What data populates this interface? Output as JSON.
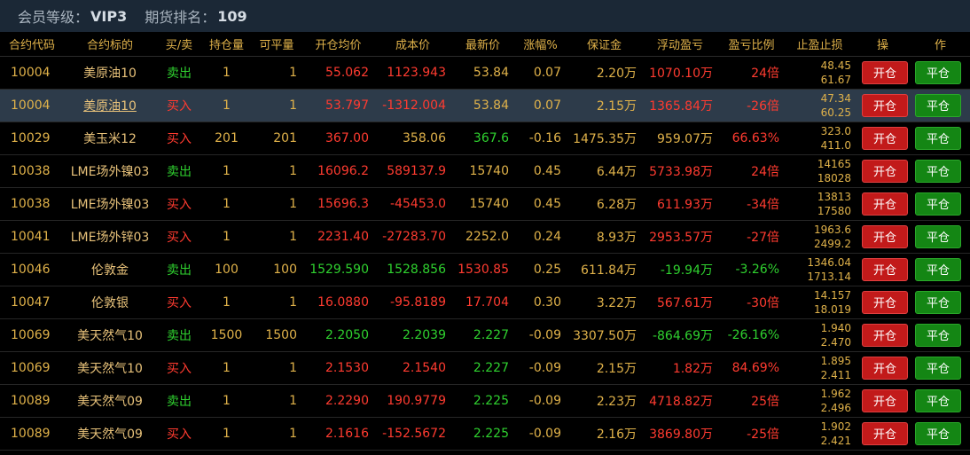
{
  "header": {
    "member_label": "会员等级：",
    "member_value": "VIP3",
    "rank_label": "期货排名：",
    "rank_value": "109"
  },
  "columns": [
    "合约代码",
    "合约标的",
    "买/卖",
    "持仓量",
    "可平量",
    "开仓均价",
    "成本价",
    "最新价",
    "涨幅%",
    "保证金",
    "浮动盈亏",
    "盈亏比例",
    "止盈止损",
    "操",
    "作"
  ],
  "buttons": {
    "open": "开仓",
    "close": "平仓"
  },
  "rows": [
    {
      "code": "10004",
      "name": "美原油10",
      "side": "卖出",
      "hold": "1",
      "avail": "1",
      "open_price": "55.062",
      "cost": "1123.943",
      "last": "53.84",
      "change": "0.07",
      "margin": "2.20万",
      "float_pl": "1070.10万",
      "pl_ratio": "24倍",
      "tp": "48.45",
      "sl": "61.67"
    },
    {
      "code": "10004",
      "name": "美原油10",
      "side": "买入",
      "hold": "1",
      "avail": "1",
      "open_price": "53.797",
      "cost": "-1312.004",
      "last": "53.84",
      "change": "0.07",
      "margin": "2.15万",
      "float_pl": "1365.84万",
      "pl_ratio": "-26倍",
      "tp": "47.34",
      "sl": "60.25"
    },
    {
      "code": "10029",
      "name": "美玉米12",
      "side": "买入",
      "hold": "201",
      "avail": "201",
      "open_price": "367.00",
      "cost": "358.06",
      "last": "367.6",
      "change": "-0.16",
      "margin": "1475.35万",
      "float_pl": "959.07万",
      "pl_ratio": "66.63%",
      "tp": "323.0",
      "sl": "411.0"
    },
    {
      "code": "10038",
      "name": "LME场外镍03",
      "side": "卖出",
      "hold": "1",
      "avail": "1",
      "open_price": "16096.2",
      "cost": "589137.9",
      "last": "15740",
      "change": "0.45",
      "margin": "6.44万",
      "float_pl": "5733.98万",
      "pl_ratio": "24倍",
      "tp": "14165",
      "sl": "18028"
    },
    {
      "code": "10038",
      "name": "LME场外镍03",
      "side": "买入",
      "hold": "1",
      "avail": "1",
      "open_price": "15696.3",
      "cost": "-45453.0",
      "last": "15740",
      "change": "0.45",
      "margin": "6.28万",
      "float_pl": "611.93万",
      "pl_ratio": "-34倍",
      "tp": "13813",
      "sl": "17580"
    },
    {
      "code": "10041",
      "name": "LME场外锌03",
      "side": "买入",
      "hold": "1",
      "avail": "1",
      "open_price": "2231.40",
      "cost": "-27283.70",
      "last": "2252.0",
      "change": "0.24",
      "margin": "8.93万",
      "float_pl": "2953.57万",
      "pl_ratio": "-27倍",
      "tp": "1963.6",
      "sl": "2499.2"
    },
    {
      "code": "10046",
      "name": "伦敦金",
      "side": "卖出",
      "hold": "100",
      "avail": "100",
      "open_price": "1529.590",
      "cost": "1528.856",
      "last": "1530.85",
      "change": "0.25",
      "margin": "611.84万",
      "float_pl": "-19.94万",
      "pl_ratio": "-3.26%",
      "tp": "1346.04",
      "sl": "1713.14"
    },
    {
      "code": "10047",
      "name": "伦敦银",
      "side": "买入",
      "hold": "1",
      "avail": "1",
      "open_price": "16.0880",
      "cost": "-95.8189",
      "last": "17.704",
      "change": "0.30",
      "margin": "3.22万",
      "float_pl": "567.61万",
      "pl_ratio": "-30倍",
      "tp": "14.157",
      "sl": "18.019"
    },
    {
      "code": "10069",
      "name": "美天然气10",
      "side": "卖出",
      "hold": "1500",
      "avail": "1500",
      "open_price": "2.2050",
      "cost": "2.2039",
      "last": "2.227",
      "change": "-0.09",
      "margin": "3307.50万",
      "float_pl": "-864.69万",
      "pl_ratio": "-26.16%",
      "tp": "1.940",
      "sl": "2.470"
    },
    {
      "code": "10069",
      "name": "美天然气10",
      "side": "买入",
      "hold": "1",
      "avail": "1",
      "open_price": "2.1530",
      "cost": "2.1540",
      "last": "2.227",
      "change": "-0.09",
      "margin": "2.15万",
      "float_pl": "1.82万",
      "pl_ratio": "84.69%",
      "tp": "1.895",
      "sl": "2.411"
    },
    {
      "code": "10089",
      "name": "美天然气09",
      "side": "卖出",
      "hold": "1",
      "avail": "1",
      "open_price": "2.2290",
      "cost": "190.9779",
      "last": "2.225",
      "change": "-0.09",
      "margin": "2.23万",
      "float_pl": "4718.82万",
      "pl_ratio": "25倍",
      "tp": "1.962",
      "sl": "2.496"
    },
    {
      "code": "10089",
      "name": "美天然气09",
      "side": "买入",
      "hold": "1",
      "avail": "1",
      "open_price": "2.1616",
      "cost": "-152.5672",
      "last": "2.225",
      "change": "-0.09",
      "margin": "2.16万",
      "float_pl": "3869.80万",
      "pl_ratio": "-25倍",
      "tp": "1.902",
      "sl": "2.421"
    }
  ],
  "colors": {
    "red": "#ff3b30",
    "green": "#2fd12f",
    "gold": "#e0b24a",
    "highlight_row": "#2d3b4a",
    "open_btn": "#c21a1a",
    "close_btn": "#148614"
  },
  "row_styles": [
    {
      "side": "green",
      "open_price": "red",
      "cost": "red",
      "last": "gold",
      "float_pl": "red",
      "pl_ratio": "red"
    },
    {
      "side": "red",
      "open_price": "red",
      "cost": "red",
      "last": "gold",
      "float_pl": "red",
      "pl_ratio": "red",
      "highlight": true,
      "name_link": true
    },
    {
      "side": "red",
      "open_price": "red",
      "cost": "gold",
      "last": "green",
      "float_pl": "gold",
      "pl_ratio": "red"
    },
    {
      "side": "green",
      "open_price": "red",
      "cost": "red",
      "last": "gold",
      "float_pl": "red",
      "pl_ratio": "red"
    },
    {
      "side": "red",
      "open_price": "red",
      "cost": "red",
      "last": "gold",
      "float_pl": "red",
      "pl_ratio": "red"
    },
    {
      "side": "red",
      "open_price": "red",
      "cost": "red",
      "last": "gold",
      "float_pl": "red",
      "pl_ratio": "red"
    },
    {
      "side": "green",
      "open_price": "green",
      "cost": "green",
      "last": "red",
      "float_pl": "green",
      "pl_ratio": "green"
    },
    {
      "side": "red",
      "open_price": "red",
      "cost": "red",
      "last": "red",
      "float_pl": "red",
      "pl_ratio": "red"
    },
    {
      "side": "green",
      "open_price": "green",
      "cost": "green",
      "last": "green",
      "float_pl": "green",
      "pl_ratio": "green"
    },
    {
      "side": "red",
      "open_price": "red",
      "cost": "red",
      "last": "green",
      "float_pl": "red",
      "pl_ratio": "red"
    },
    {
      "side": "green",
      "open_price": "red",
      "cost": "red",
      "last": "green",
      "float_pl": "red",
      "pl_ratio": "red"
    },
    {
      "side": "red",
      "open_price": "red",
      "cost": "red",
      "last": "green",
      "float_pl": "red",
      "pl_ratio": "red"
    }
  ]
}
